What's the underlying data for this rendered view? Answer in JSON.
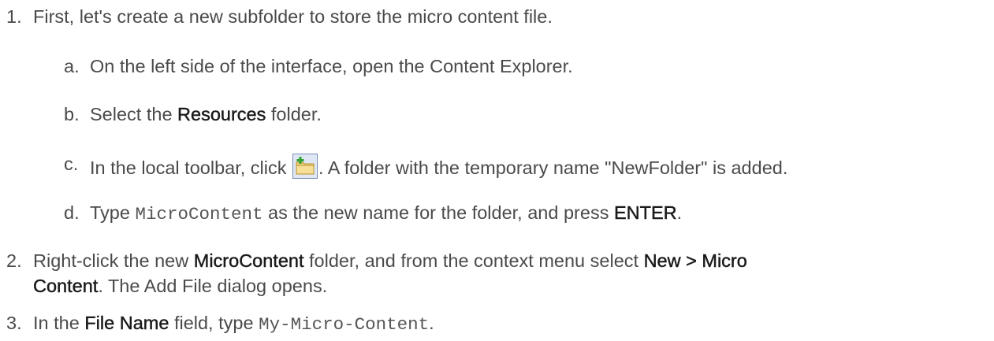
{
  "steps": [
    {
      "number": "1.",
      "text": "First, let's create a new subfolder to store the micro content file.",
      "substeps": [
        {
          "letter": "a.",
          "text": "On the left side of the interface, open the Content Explorer."
        },
        {
          "letter": "b.",
          "pre": "Select the ",
          "bold": "Resources",
          "post": " folder."
        },
        {
          "letter": "c.",
          "pre": "In the local toolbar, click ",
          "icon": "new-folder-icon",
          "post": ". A folder with the temporary name \"NewFolder\" is added."
        },
        {
          "letter": "d.",
          "pre": "Type ",
          "code": "MicroContent",
          "mid": " as the new name for the folder, and press ",
          "bold": "ENTER",
          "post": "."
        }
      ]
    },
    {
      "number": "2.",
      "line1_pre": "Right-click the new ",
      "line1_bold1": "MicroContent",
      "line1_mid": " folder, and from the context menu select ",
      "line1_bold2": "New > Micro",
      "line2_bold": "Content",
      "line2_post": ". The Add File dialog opens."
    },
    {
      "number": "3.",
      "pre": "In the ",
      "bold": "File Name",
      "mid": " field, type ",
      "code": "My-Micro-Content",
      "post": "."
    }
  ]
}
